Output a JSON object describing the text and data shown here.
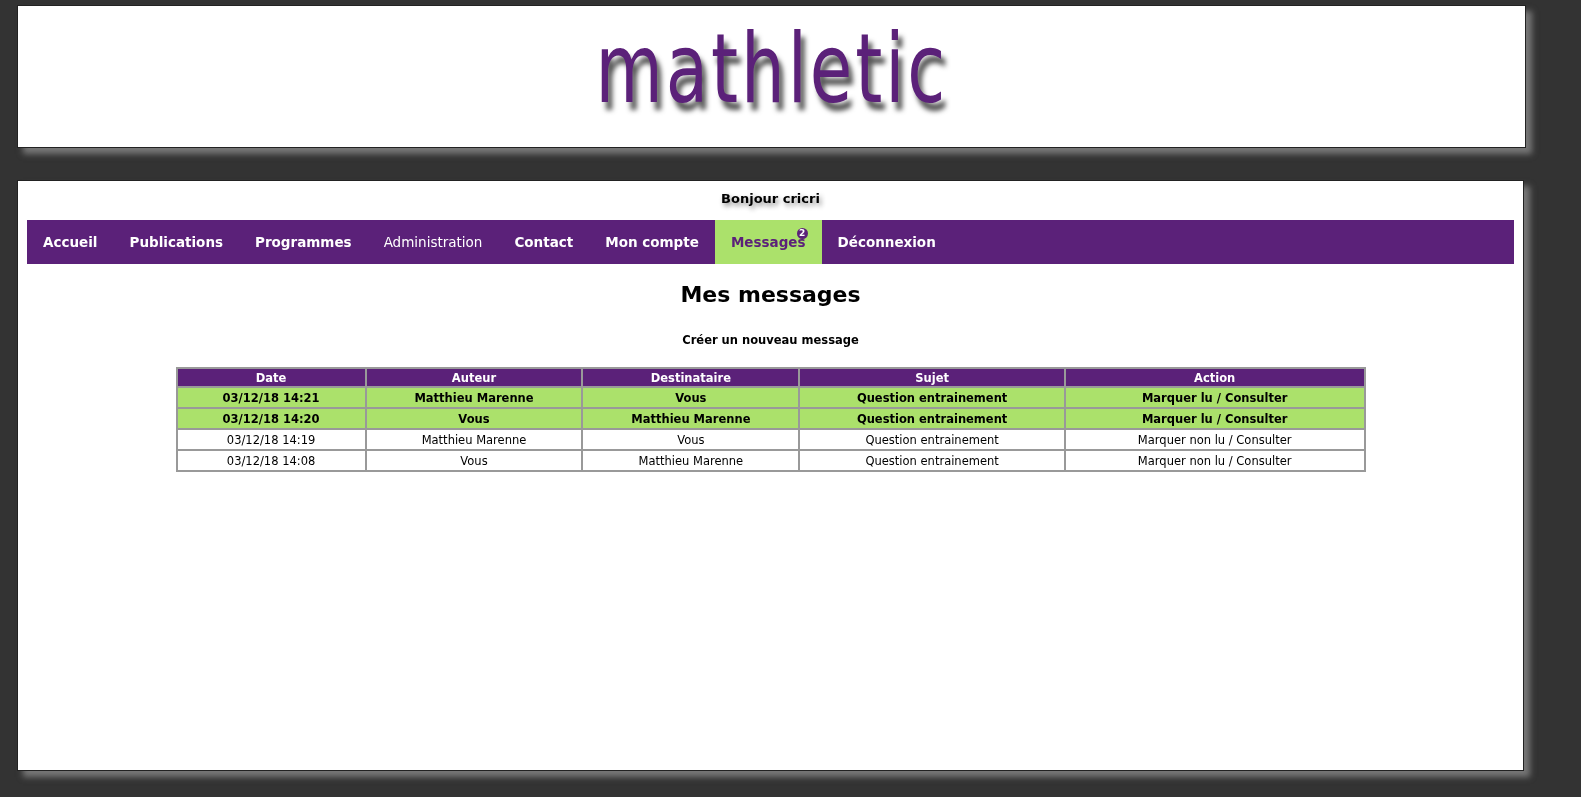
{
  "header": {
    "logo": "mathletic"
  },
  "greeting": "Bonjour cricri",
  "nav": [
    {
      "label": "Accueil",
      "bold": true,
      "selected": false
    },
    {
      "label": "Publications",
      "bold": true,
      "selected": false
    },
    {
      "label": "Programmes",
      "bold": true,
      "selected": false
    },
    {
      "label": "Administration",
      "bold": false,
      "selected": false
    },
    {
      "label": "Contact",
      "bold": true,
      "selected": false
    },
    {
      "label": "Mon compte",
      "bold": true,
      "selected": false
    },
    {
      "label": "Messages",
      "bold": true,
      "selected": true,
      "badge": "2"
    },
    {
      "label": "Déconnexion",
      "bold": true,
      "selected": false
    }
  ],
  "page_title": "Mes messages",
  "new_message_link": "Créer un nouveau message",
  "table": {
    "columns": [
      "Date",
      "Auteur",
      "Destinataire",
      "Sujet",
      "Action"
    ],
    "rows": [
      {
        "unread": true,
        "cells": [
          "03/12/18 14:21",
          "Matthieu Marenne",
          "Vous",
          "Question entrainement",
          "Marquer lu / Consulter"
        ]
      },
      {
        "unread": true,
        "cells": [
          "03/12/18 14:20",
          "Vous",
          "Matthieu Marenne",
          "Question entrainement",
          "Marquer lu / Consulter"
        ]
      },
      {
        "unread": false,
        "cells": [
          "03/12/18 14:19",
          "Matthieu Marenne",
          "Vous",
          "Question entrainement",
          "Marquer non lu / Consulter"
        ]
      },
      {
        "unread": false,
        "cells": [
          "03/12/18 14:08",
          "Vous",
          "Matthieu Marenne",
          "Question entrainement",
          "Marquer non lu / Consulter"
        ]
      }
    ]
  }
}
